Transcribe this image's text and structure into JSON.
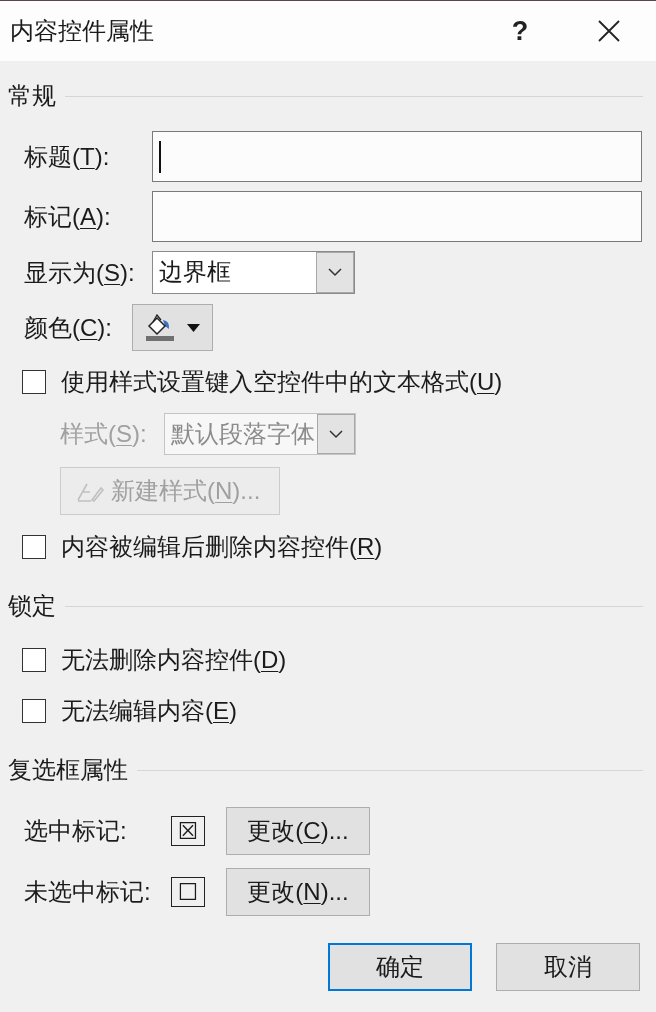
{
  "window": {
    "title": "内容控件属性",
    "help_button": "?"
  },
  "sections": [
    {
      "heading": "常规",
      "items": [
        {
          "kind": "text_field",
          "label": "标题(",
          "mnemonic": "T",
          "label_end": "):",
          "focused": true
        },
        {
          "kind": "text_field",
          "label": "标记(",
          "mnemonic": "A",
          "label_end": "):",
          "focused": false
        },
        {
          "kind": "dropdown",
          "label": "显示为(",
          "mnemonic": "S",
          "label_end": "):",
          "value": "边界框",
          "disabled": false
        },
        {
          "kind": "color_picker",
          "label": "颜色(",
          "mnemonic": "C",
          "label_end": "):"
        },
        {
          "kind": "checkbox",
          "label": "使用样式设置键入空控件中的文本格式(",
          "mnemonic": "U",
          "label_end": ")",
          "checked": false,
          "children": [
            {
              "kind": "dropdown",
              "label": "样式(",
              "mnemonic": "S",
              "label_end": "):",
              "value": "默认段落字体",
              "disabled": true
            },
            {
              "kind": "button",
              "label": "新建样式(",
              "mnemonic": "N",
              "label_end": ")...",
              "disabled": true
            }
          ]
        },
        {
          "kind": "checkbox",
          "label": "内容被编辑后删除内容控件(",
          "mnemonic": "R",
          "label_end": ")",
          "checked": false
        }
      ]
    },
    {
      "heading": "锁定",
      "items": [
        {
          "kind": "checkbox",
          "label": "无法删除内容控件(",
          "mnemonic": "D",
          "label_end": ")",
          "checked": false
        },
        {
          "kind": "checkbox",
          "label": "无法编辑内容(",
          "mnemonic": "E",
          "label_end": ")",
          "checked": false
        }
      ]
    },
    {
      "heading": "复选框属性",
      "items": [
        {
          "kind": "symbol_row",
          "label": "选中标记:",
          "symbol": "☒",
          "button": {
            "label": "更改(",
            "mnemonic": "C",
            "label_end": ")..."
          }
        },
        {
          "kind": "symbol_row",
          "label": "未选中标记:",
          "symbol": "☐",
          "button": {
            "label": "更改(",
            "mnemonic": "N",
            "label_end": ")..."
          }
        }
      ]
    }
  ],
  "buttons": [
    {
      "label": "确定",
      "default": true
    },
    {
      "label": "取消",
      "default": false
    }
  ]
}
